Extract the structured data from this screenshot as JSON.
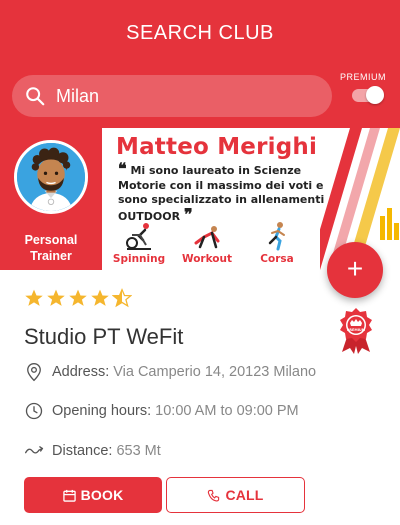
{
  "header": {
    "title": "SEARCH CLUB",
    "search_value": "Milan",
    "premium_label": "PREMIUM",
    "premium_toggle_on": true,
    "accent_color": "#e5333c"
  },
  "banner": {
    "name": "Matteo Merighi",
    "quote": "Mi sono laureato in Scienze Motorie con il massimo dei voti e sono specializzato in allenamenti OUTDOOR",
    "role_line1": "Personal",
    "role_line2": "Trainer",
    "activities": [
      {
        "label": "Spinning",
        "icon": "spinning-bike-icon"
      },
      {
        "label": "Workout",
        "icon": "workout-icon"
      },
      {
        "label": "Corsa",
        "icon": "running-icon"
      }
    ]
  },
  "club": {
    "rating": 4.5,
    "rating_max": 5,
    "name": "Studio PT WeFit",
    "address_label": "Address:",
    "address_value": "Via Camperio 14, 20123 Milano",
    "hours_label": "Opening hours:",
    "hours_value": "10:00 AM to 09:00 PM",
    "distance_label": "Distance:",
    "distance_value": "653 Mt",
    "premium_badge_text": "PREMIUM"
  },
  "actions": {
    "add_label": "+",
    "book_label": "BOOK",
    "call_label": "CALL"
  }
}
